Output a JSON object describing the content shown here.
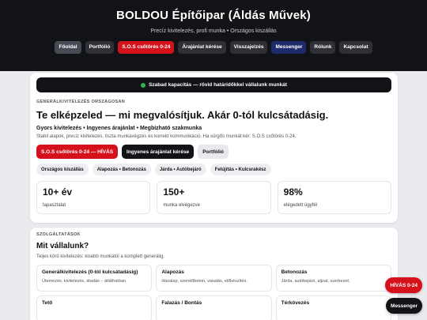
{
  "header": {
    "brand": "BOLDOU Építőipar (Áldás Művek)",
    "tagline": "Precíz kivitelezés, profi munka • Országos kiszállás"
  },
  "nav": [
    {
      "label": "Főoldal"
    },
    {
      "label": "Portfólió"
    },
    {
      "label": "S.O.S csőtörés 0-24"
    },
    {
      "label": "Árajánlat kérése"
    },
    {
      "label": "Visszajelzés"
    },
    {
      "label": "Messenger"
    },
    {
      "label": "Rólunk"
    },
    {
      "label": "Kapcsolat"
    }
  ],
  "hero": {
    "banner": "Szabad kapacitás — rövid határidőkkel vállalunk munkát",
    "eyebrow": "GENERÁLKIVITELEZÉS ORSZÁGOSAN",
    "headline": "Te elképzeled — mi megvalósítjuk. Akár 0-tól kulcsátadásig.",
    "subheadline": "Gyors kivitelezés • Ingyenes árajánlat • Megbízható szakmunka",
    "description": "Stabil alapok, precíz kivitelezés, tiszta munkavégzés és korrekt kommunikáció. Ha sürgős munkát kér: S.O.S csőtörés 0-24.",
    "buttons": {
      "sos": "S.O.S csőtörés 0-24 — HÍVÁS",
      "quote": "Ingyenes árajánlat kérése",
      "portfolio": "Portfólió"
    },
    "tags": [
      "Országos kiszállás",
      "Alapozás • Betonozás",
      "Járda • Autóbejáró",
      "Felújítás • Kulcsrakész"
    ],
    "stats": [
      {
        "value": "10+ év",
        "label": "tapasztalat"
      },
      {
        "value": "150+",
        "label": "munka elvégezve"
      },
      {
        "value": "98%",
        "label": "elégedett ügyfél"
      }
    ]
  },
  "services": {
    "eyebrow": "SZOLGÁLTATÁSOK",
    "title": "Mit vállalunk?",
    "description": "Teljes körű kivitelezés: kisebb munkától a komplett generálig.",
    "items": [
      {
        "title": "Generálkivitelezés (0-tól kulcsátadásig)",
        "desc": "Ütemezés, kivitelezés, átadás – átláthatóan."
      },
      {
        "title": "Alapozás",
        "desc": "Házalap, szerelőbeton, vasalás, előkészítés."
      },
      {
        "title": "Betonozás",
        "desc": "Járda, autóbejáró, aljzat, szerkezet."
      },
      {
        "title": "Tető",
        "desc": ""
      },
      {
        "title": "Falazás / Bontás",
        "desc": ""
      },
      {
        "title": "Térkövezés",
        "desc": ""
      }
    ]
  },
  "floating": {
    "call": "HÍVÁS 0-24",
    "messenger": "Messenger"
  }
}
